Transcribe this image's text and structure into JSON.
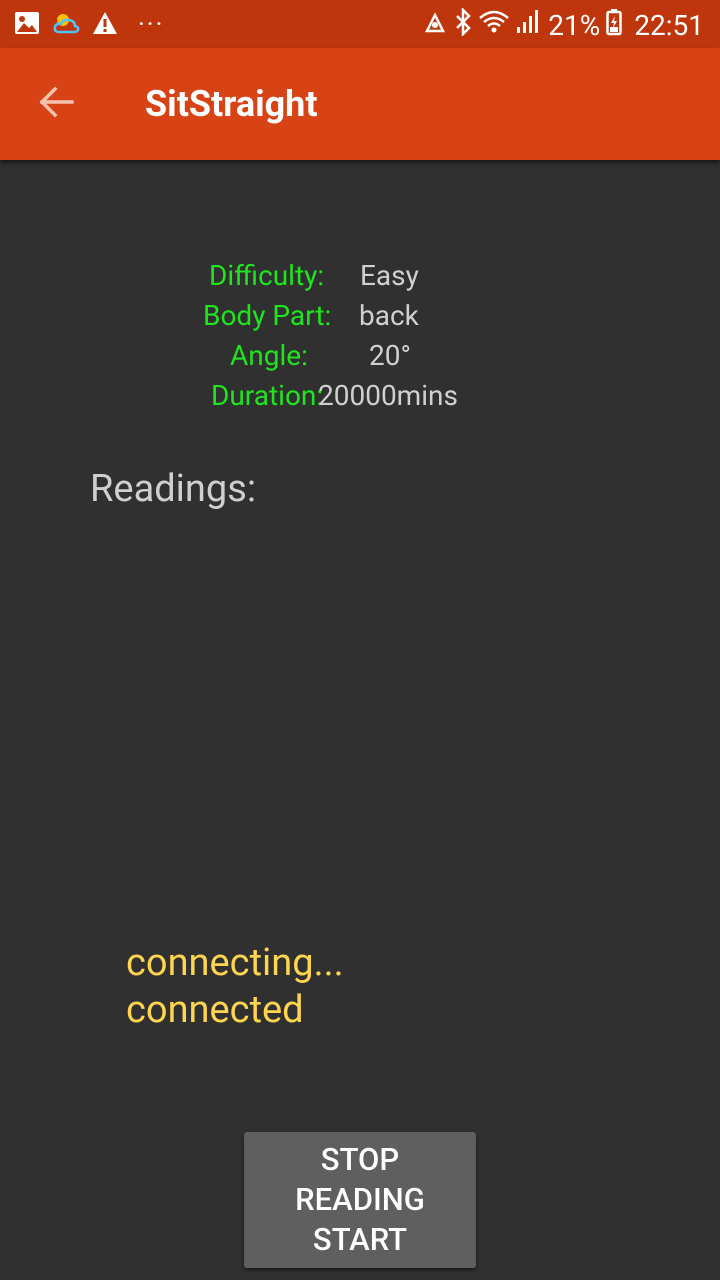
{
  "status_bar": {
    "icons_left": [
      "image-icon",
      "weather-cloud-icon",
      "warning-icon"
    ],
    "more": "···",
    "icons_right": [
      "nfc-icon",
      "bluetooth-icon",
      "wifi-icon",
      "signal-icon",
      "battery-icon"
    ],
    "battery_percent": "21%",
    "time": "22:51"
  },
  "toolbar": {
    "back_icon": "arrow-back-icon",
    "title": "SitStraight",
    "color": "#d84315"
  },
  "settings": {
    "difficulty_label": "Difficulty:",
    "difficulty_value": "Easy",
    "body_part_label": "Body Part:",
    "body_part_value": "back",
    "angle_label": "Angle:",
    "angle_value": "20°",
    "duration_label": "Duration:",
    "duration_value": "20000mins"
  },
  "readings_label": "Readings:",
  "connection_status": {
    "line1": "connecting...",
    "line2": "connected"
  },
  "action_button": {
    "line1": "STOP",
    "line2": "READING",
    "line3": "START"
  },
  "colors": {
    "background": "#303030",
    "label_green": "#1ee51e",
    "status_yellow": "#ffd54f",
    "status_bar": "#bf360c"
  }
}
